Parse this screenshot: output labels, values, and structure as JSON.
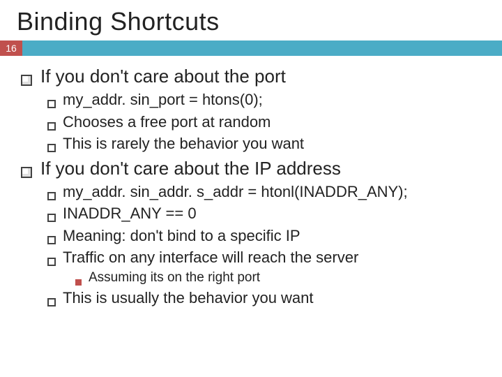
{
  "slide_number": "16",
  "title": "Binding Shortcuts",
  "section1": {
    "heading": "If you don't care about the port",
    "items": [
      "my_addr. sin_port = htons(0);",
      "Chooses a free port at random",
      "This is rarely the behavior you want"
    ]
  },
  "section2": {
    "heading": "If you don't care about the IP address",
    "items": [
      "my_addr. sin_addr. s_addr = htonl(INADDR_ANY);",
      "INADDR_ANY == 0",
      "Meaning: don't bind to a specific IP",
      "Traffic on any interface will reach the server"
    ],
    "subitems": [
      "Assuming its on the right port"
    ],
    "items_after": [
      "This is usually the behavior you want"
    ]
  }
}
